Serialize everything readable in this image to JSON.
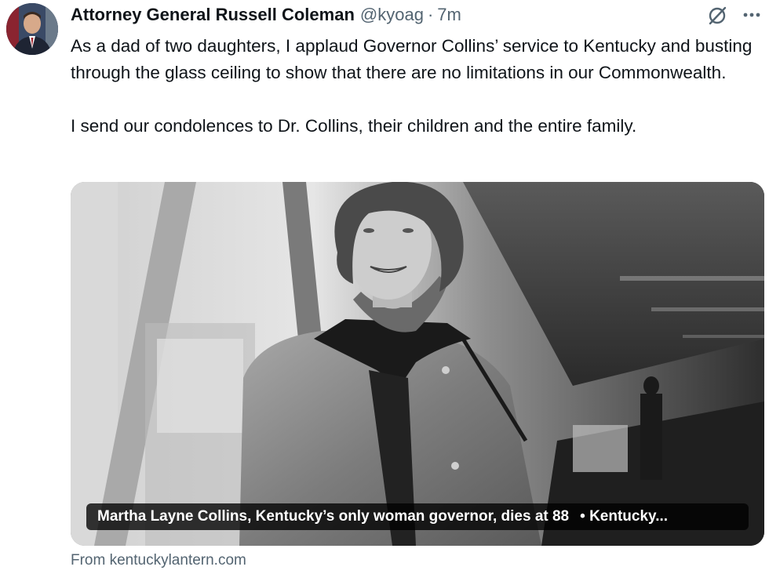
{
  "tweet": {
    "author_name": "Attorney General Russell Coleman",
    "handle": "@kyoag",
    "separator": "·",
    "time": "7m",
    "paragraphs": [
      "As a dad of two daughters, I applaud Governor Collins’ service to Kentucky and busting through the glass ceiling to show that there are no limitations in our Commonwealth.",
      "I send our condolences to Dr. Collins, their children and the entire family."
    ]
  },
  "icons": {
    "avatar": "avatar-photo",
    "grok": "grok-icon",
    "more": "more-icon"
  },
  "card": {
    "title": "Martha Layne Collins, Kentucky’s only woman governor, dies at 88",
    "site_label": "• Kentucky...",
    "source": "From kentuckylantern.com"
  },
  "colors": {
    "text": "#0f1419",
    "secondary": "#536471",
    "caption_bg": "#000000"
  }
}
